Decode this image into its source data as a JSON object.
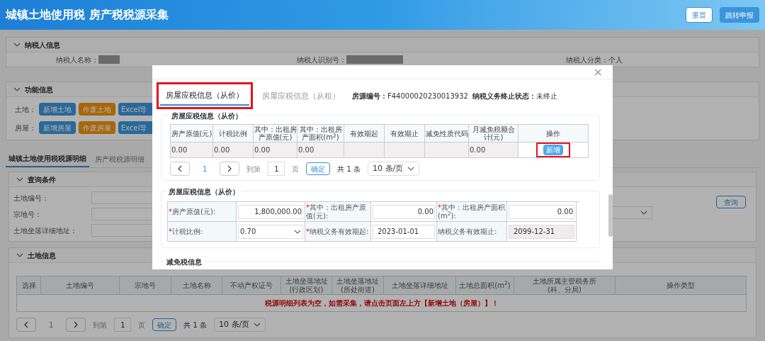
{
  "header": {
    "title": "城镇土地使用税 房产税税源采集",
    "buttons": [
      {
        "label": "重置",
        "kind": "outline"
      },
      {
        "label": "跳转申报",
        "kind": "primary"
      }
    ]
  },
  "taxpayer_panel": {
    "title": "纳税人信息",
    "fields": [
      {
        "label": "纳税人名称：",
        "masked": true
      },
      {
        "label": "纳税人识别号：",
        "masked": true
      },
      {
        "label": "纳税人分类：",
        "value": "个人",
        "masked": false
      }
    ]
  },
  "function_panel": {
    "title": "功能信息",
    "rows": [
      {
        "label": "土地：",
        "buttons": [
          {
            "label": "新增土地",
            "kind": "primary"
          },
          {
            "label": "作废土地",
            "kind": "warning"
          },
          {
            "label": "Excel导",
            "kind": "primary"
          }
        ]
      },
      {
        "label": "房屋：",
        "buttons": [
          {
            "label": "新增房屋",
            "kind": "primary"
          },
          {
            "label": "作废房屋",
            "kind": "warning"
          },
          {
            "label": "Excel导",
            "kind": "primary"
          }
        ]
      }
    ]
  },
  "detail_tabs": [
    {
      "label": "城镇土地使用税税源明细",
      "selected": true
    },
    {
      "label": "房产税税源明细",
      "selected": false
    }
  ],
  "query_panel": {
    "title": "查询条件",
    "fields": [
      "土地编号：",
      "宗地号：",
      "土地坐落详细地址："
    ],
    "button": "查询"
  },
  "land_panel": {
    "title": "土地信息",
    "columns": [
      "选择",
      "土地编号",
      "宗地号",
      "土地名称",
      "不动产权证号",
      "土地坐落地址\n(行政区划)",
      "土地坐落地址\n(所处街道)",
      "土地坐落详细地址",
      "土地总面积(m$^{2}$)",
      "土地所属主管税务所\n(科、分局)",
      "操作类型"
    ],
    "empty_message": "税源明细列表为空，如需采集，请点击页面左上方【新增土地（房屋）】！",
    "pagination": {
      "page": "1",
      "goto_label": "到第",
      "goto_value": "1",
      "page_unit": "页",
      "confirm": "确定",
      "total": "共 1 条",
      "page_size": "10 条/页"
    }
  },
  "modal": {
    "close": "×",
    "tabs": [
      {
        "label": "房屋应税信息（从价）",
        "selected": true,
        "highlighted": true
      },
      {
        "label": "房屋应税信息（从租）",
        "selected": false,
        "highlighted": false
      }
    ],
    "source_label": "房源编号：",
    "source_value": "F44000020230013932",
    "status_label": "纳税义务终止状态：",
    "status_value": "未终止",
    "list_section": {
      "title": "房屋应税信息（从价）",
      "columns": [
        "房产原值(元)",
        "计税比例",
        "其中：出租房产原值(元)",
        "其中：出租房产面积(m$^{2}$)",
        "有效期起",
        "有效期止",
        "减免性质代码",
        "月减免税额合计(元)",
        "操作"
      ],
      "rows": [
        {
          "cells": [
            "0.00",
            "0.00",
            "0.00",
            "0.00",
            "",
            "",
            "",
            "0.00"
          ],
          "action": {
            "label": "新增",
            "highlighted": true
          }
        }
      ],
      "pagination": {
        "page": "1",
        "goto_label": "到第",
        "goto_value": "1",
        "page_unit": "页",
        "confirm": "确定",
        "total": "共 1 条",
        "page_size": "10 条/页"
      }
    },
    "form_section": {
      "title": "房屋应税信息（从价）",
      "required_mark": "*",
      "fields": [
        {
          "label": "房产原值(元):",
          "value": "1,800,000.00",
          "required": true,
          "kind": "number",
          "disabled": false
        },
        {
          "label": "其中：出租房产原值(元):",
          "value": "0.00",
          "required": true,
          "kind": "number",
          "disabled": false
        },
        {
          "label": "其中：出租房产面积(m$^{2}$):",
          "value": "0.00",
          "required": true,
          "kind": "number",
          "disabled": false
        },
        {
          "label": "计税比例:",
          "value": "0.70",
          "required": true,
          "kind": "select",
          "disabled": false
        },
        {
          "label": "纳税义务有效期起:",
          "value": "2023-01-01",
          "required": true,
          "kind": "date",
          "disabled": false
        },
        {
          "label": "纳税义务有效期止:",
          "value": "2099-12-31",
          "required": false,
          "kind": "date",
          "disabled": true
        }
      ]
    },
    "next_section_title": "减免税信息"
  }
}
